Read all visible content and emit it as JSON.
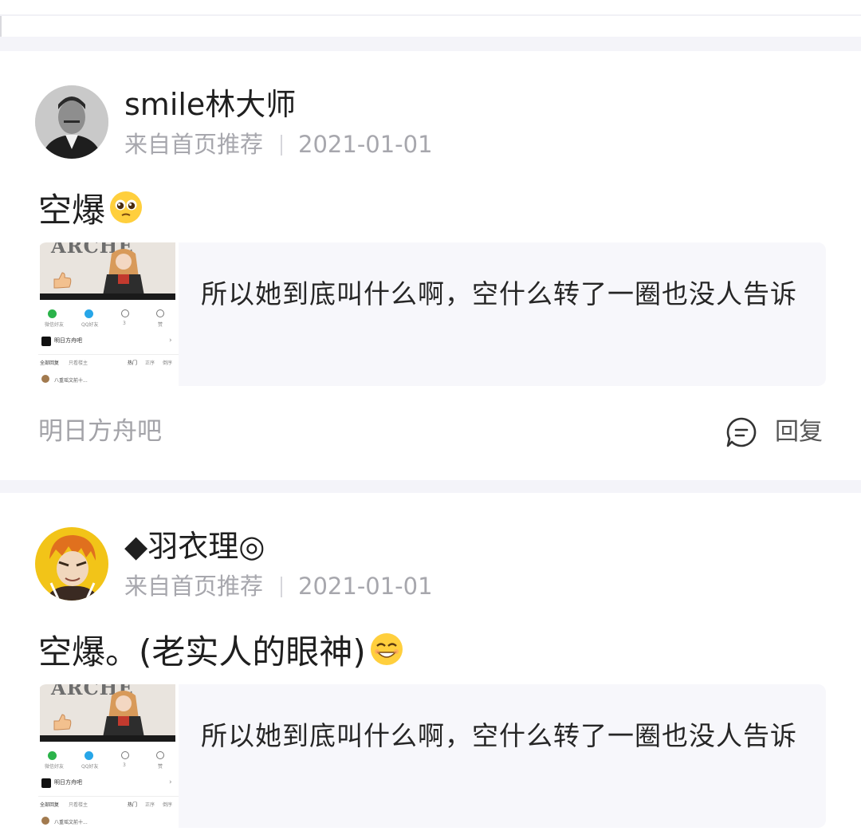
{
  "posts": [
    {
      "username": "smile林大师",
      "source": "来自首页推荐",
      "date": "2021-01-01",
      "content": "空爆",
      "emoji_icon": "pleading-face-icon",
      "quote_text": "所以她到底叫什么啊，空什么转了一圈也没人告诉",
      "thumbnail": {
        "banner_text": "ARCHE",
        "share_labels": [
          "微信好友",
          "QQ好友",
          "3",
          "赞"
        ],
        "forum_name": "明日方舟吧",
        "tabs": [
          "全部回复",
          "只看楼主",
          "热门",
          "正序",
          "倒序"
        ],
        "comment_preview": "八重瑶文前十..."
      },
      "forum": "明日方舟吧",
      "reply_label": "回复"
    },
    {
      "username": "◆羽衣理◎",
      "source": "来自首页推荐",
      "date": "2021-01-01",
      "content": "空爆。(老实人的眼神)",
      "emoji_icon": "smiling-face-icon",
      "quote_text": "所以她到底叫什么啊，空什么转了一圈也没人告诉",
      "thumbnail": {
        "banner_text": "ARCHE",
        "share_labels": [
          "微信好友",
          "QQ好友",
          "3",
          "赞"
        ],
        "forum_name": "明日方舟吧",
        "tabs": [
          "全部回复",
          "只看楼主",
          "热门",
          "正序",
          "倒序"
        ],
        "comment_preview": "八重瑶文前十..."
      }
    }
  ],
  "colors": {
    "divider": "#f4f4f9",
    "quote_bg": "#f7f7fb",
    "meta_text": "#a7a7ad"
  }
}
